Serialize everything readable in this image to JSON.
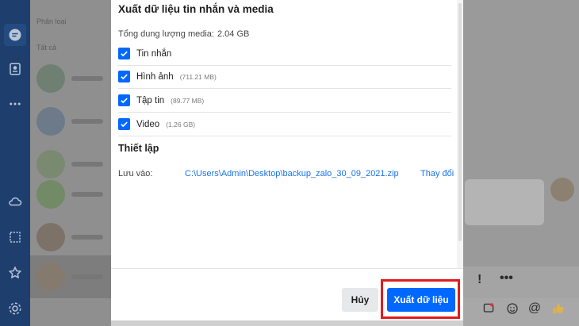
{
  "background": {
    "list_header": "Phân loại",
    "list_subheader": "Tất cả"
  },
  "dialog": {
    "title": "Xuất dữ liệu tin nhắn và media",
    "total_label": "Tổng dung lượng media:",
    "total_value": "2.04 GB",
    "options": [
      {
        "label": "Tin nhắn",
        "size": "",
        "checked": true
      },
      {
        "label": "Hình ảnh",
        "size": "(711.21 MB)",
        "checked": true
      },
      {
        "label": "Tập tin",
        "size": "(89.77 MB)",
        "checked": true
      },
      {
        "label": "Video",
        "size": "(1.26 GB)",
        "checked": true
      }
    ],
    "settings_title": "Thiết lập",
    "save_label": "Lưu vào:",
    "save_path": "C:\\Users\\Admin\\Desktop\\backup_zalo_30_09_2021.zip",
    "change_link": "Thay đổi",
    "cancel_button": "Hủy",
    "export_button": "Xuất dữ liệu"
  },
  "colors": {
    "accent": "#0068ff",
    "link": "#1a73e8",
    "highlight": "#e21b1b",
    "rail": "#1e3f6e"
  },
  "icons": {
    "rail": [
      "chat-icon",
      "contacts-icon",
      "more-icon",
      "cloud-icon",
      "screenshot-icon",
      "star-icon",
      "settings-icon"
    ],
    "chat_toolbar": [
      "important-icon",
      "more-icon"
    ],
    "chat_input": [
      "sticker-icon",
      "emoji-icon",
      "mention-icon",
      "thumbs-up-icon"
    ]
  }
}
